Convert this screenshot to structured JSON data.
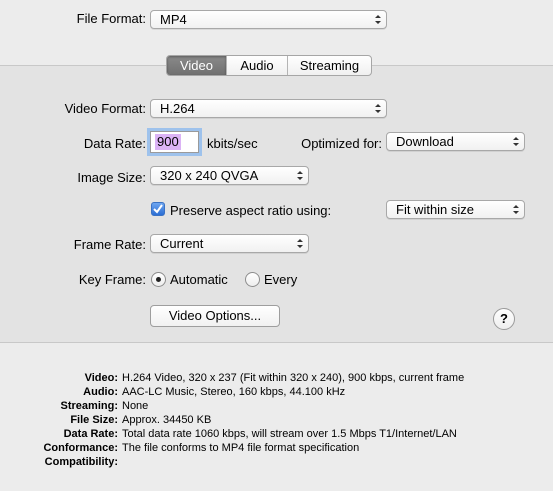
{
  "file_format": {
    "label": "File Format:",
    "value": "MP4"
  },
  "tabs": [
    {
      "label": "Video",
      "active": true
    },
    {
      "label": "Audio",
      "active": false
    },
    {
      "label": "Streaming",
      "active": false
    }
  ],
  "video": {
    "format_label": "Video Format:",
    "format_value": "H.264",
    "data_rate_label": "Data Rate:",
    "data_rate_value": "900",
    "data_rate_unit": "kbits/sec",
    "optimized_label": "Optimized for:",
    "optimized_value": "Download",
    "image_size_label": "Image Size:",
    "image_size_value": "320 x 240 QVGA",
    "preserve_label": "Preserve aspect ratio using:",
    "preserve_checked": true,
    "preserve_value": "Fit within size",
    "frame_rate_label": "Frame Rate:",
    "frame_rate_value": "Current",
    "key_frame_label": "Key Frame:",
    "key_frame_automatic": "Automatic",
    "key_frame_every": "Every",
    "key_frame_selected": "Automatic",
    "options_button": "Video Options...",
    "help": "?"
  },
  "summary": [
    {
      "key": "Video:",
      "value": "H.264 Video, 320 x 237 (Fit within 320 x 240), 900 kbps, current frame"
    },
    {
      "key": "Audio:",
      "value": "AAC-LC Music, Stereo, 160 kbps, 44.100 kHz"
    },
    {
      "key": "Streaming:",
      "value": "None"
    },
    {
      "key": "File Size:",
      "value": "Approx. 34450 KB"
    },
    {
      "key": "Data Rate:",
      "value": "Total data rate 1060 kbps, will stream over 1.5 Mbps T1/Internet/LAN"
    },
    {
      "key": "Conformance:",
      "value": "The file conforms to MP4 file format specification"
    },
    {
      "key": "Compatibility:",
      "value": ""
    }
  ],
  "colors": {
    "focus_ring": "#9ec2ec",
    "selection": "#dbb3f5",
    "checkbox_blue": "#2b6ed4",
    "active_tab": "#7a7a7a"
  }
}
